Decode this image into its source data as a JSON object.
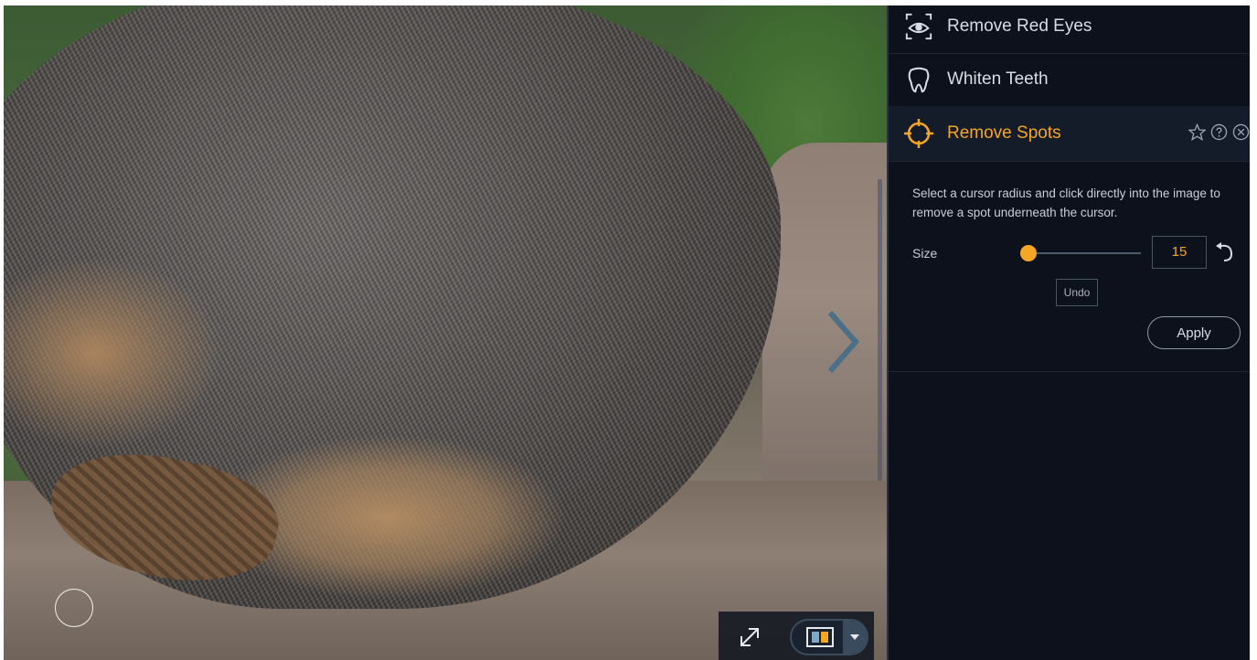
{
  "tools": [
    {
      "label": "Remove Red Eyes",
      "icon": "red-eye-icon"
    },
    {
      "label": "Whiten Teeth",
      "icon": "tooth-icon"
    },
    {
      "label": "Remove Spots",
      "icon": "crosshair-icon",
      "active": true
    }
  ],
  "remove_spots": {
    "description": "Select a cursor radius and click directly into the image to remove a spot underneath the cursor.",
    "size_label": "Size",
    "size_value": "15",
    "undo_label": "Undo",
    "apply_label": "Apply",
    "slider_level_fraction": 0.0
  },
  "canvas_toolbar": {
    "expand_icon": "expand-icon",
    "compare_icon": "compare-view-icon",
    "dropdown_icon": "chevron-down-icon"
  },
  "colors": {
    "accent": "#f5a623",
    "panel_bg": "#0c111b",
    "text": "#d7dde4"
  }
}
